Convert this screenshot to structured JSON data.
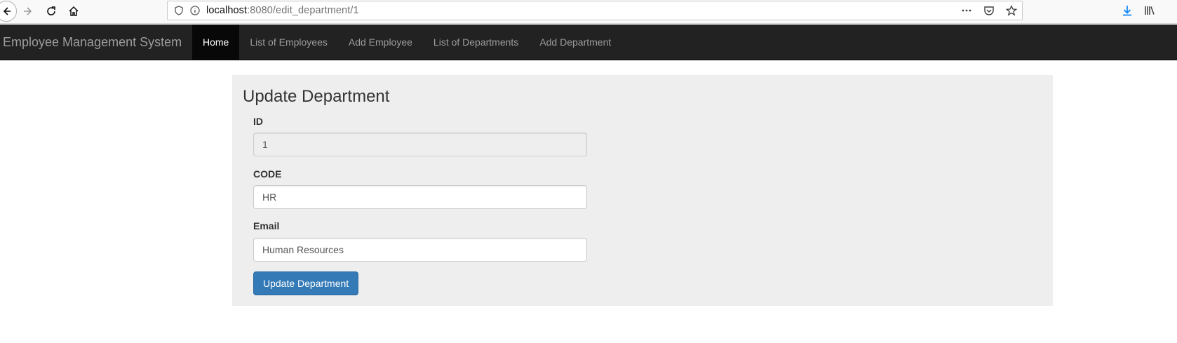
{
  "browser": {
    "url_host": "localhost",
    "url_path": ":8080/edit_department/1"
  },
  "navbar": {
    "brand": "Employee Management System",
    "items": [
      {
        "label": "Home",
        "active": true
      },
      {
        "label": "List of Employees",
        "active": false
      },
      {
        "label": "Add Employee",
        "active": false
      },
      {
        "label": "List of Departments",
        "active": false
      },
      {
        "label": "Add Department",
        "active": false
      }
    ]
  },
  "form": {
    "title": "Update Department",
    "id_label": "ID",
    "id_value": "1",
    "code_label": "CODE",
    "code_value": "HR",
    "email_label": "Email",
    "email_value": "Human Resources",
    "submit_label": "Update Department"
  },
  "colors": {
    "navbar_bg": "#222222",
    "panel_bg": "#eeeeee",
    "primary_button": "#337ab7",
    "download_icon": "#0a84ff"
  }
}
